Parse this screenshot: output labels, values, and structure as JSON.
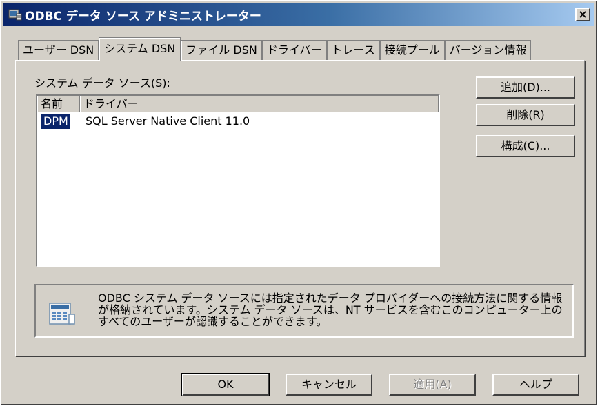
{
  "window": {
    "title": "ODBC データ ソース アドミニストレーター",
    "close_label": "×",
    "title_icon": "odbc-admin-icon"
  },
  "tabs": [
    {
      "label": "ユーザー DSN",
      "active": false
    },
    {
      "label": "システム DSN",
      "active": true
    },
    {
      "label": "ファイル DSN",
      "active": false
    },
    {
      "label": "ドライバー",
      "active": false
    },
    {
      "label": "トレース",
      "active": false
    },
    {
      "label": "接続プール",
      "active": false
    },
    {
      "label": "バージョン情報",
      "active": false
    }
  ],
  "system_dsn": {
    "label": "システム データ ソース(S):",
    "columns": [
      "名前",
      "ドライバー"
    ],
    "rows": [
      {
        "name": "DPM",
        "driver": "SQL Server Native Client 11.0",
        "selected": true
      }
    ],
    "buttons": {
      "add": "追加(D)...",
      "remove": "削除(R)",
      "configure": "構成(C)..."
    },
    "info_text": "ODBC システム データ ソースには指定されたデータ プロバイダーへの接続方法に関する情報が格納されています。システム データ ソースは、NT サービスを含むこのコンピューター上のすべてのユーザーが認識することができます。",
    "info_icon": "datasource-info-icon"
  },
  "footer": {
    "ok": "OK",
    "cancel": "キャンセル",
    "apply": "適用(A)",
    "help": "ヘルプ"
  },
  "colors": {
    "title_bar_start": "#0a246a",
    "title_bar_end": "#a6caf0",
    "dialog_face": "#d4d0c8",
    "selection": "#0a246a"
  }
}
